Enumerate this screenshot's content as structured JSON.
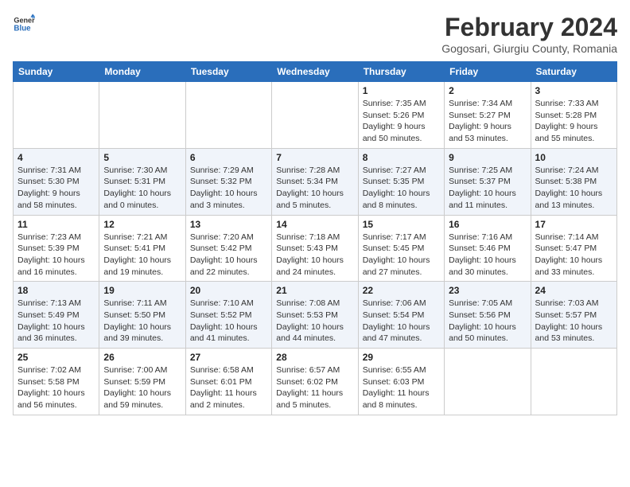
{
  "header": {
    "logo_line1": "General",
    "logo_line2": "Blue",
    "month_year": "February 2024",
    "location": "Gogosari, Giurgiu County, Romania"
  },
  "weekdays": [
    "Sunday",
    "Monday",
    "Tuesday",
    "Wednesday",
    "Thursday",
    "Friday",
    "Saturday"
  ],
  "weeks": [
    [
      {
        "day": "",
        "info": ""
      },
      {
        "day": "",
        "info": ""
      },
      {
        "day": "",
        "info": ""
      },
      {
        "day": "",
        "info": ""
      },
      {
        "day": "1",
        "info": "Sunrise: 7:35 AM\nSunset: 5:26 PM\nDaylight: 9 hours\nand 50 minutes."
      },
      {
        "day": "2",
        "info": "Sunrise: 7:34 AM\nSunset: 5:27 PM\nDaylight: 9 hours\nand 53 minutes."
      },
      {
        "day": "3",
        "info": "Sunrise: 7:33 AM\nSunset: 5:28 PM\nDaylight: 9 hours\nand 55 minutes."
      }
    ],
    [
      {
        "day": "4",
        "info": "Sunrise: 7:31 AM\nSunset: 5:30 PM\nDaylight: 9 hours\nand 58 minutes."
      },
      {
        "day": "5",
        "info": "Sunrise: 7:30 AM\nSunset: 5:31 PM\nDaylight: 10 hours\nand 0 minutes."
      },
      {
        "day": "6",
        "info": "Sunrise: 7:29 AM\nSunset: 5:32 PM\nDaylight: 10 hours\nand 3 minutes."
      },
      {
        "day": "7",
        "info": "Sunrise: 7:28 AM\nSunset: 5:34 PM\nDaylight: 10 hours\nand 5 minutes."
      },
      {
        "day": "8",
        "info": "Sunrise: 7:27 AM\nSunset: 5:35 PM\nDaylight: 10 hours\nand 8 minutes."
      },
      {
        "day": "9",
        "info": "Sunrise: 7:25 AM\nSunset: 5:37 PM\nDaylight: 10 hours\nand 11 minutes."
      },
      {
        "day": "10",
        "info": "Sunrise: 7:24 AM\nSunset: 5:38 PM\nDaylight: 10 hours\nand 13 minutes."
      }
    ],
    [
      {
        "day": "11",
        "info": "Sunrise: 7:23 AM\nSunset: 5:39 PM\nDaylight: 10 hours\nand 16 minutes."
      },
      {
        "day": "12",
        "info": "Sunrise: 7:21 AM\nSunset: 5:41 PM\nDaylight: 10 hours\nand 19 minutes."
      },
      {
        "day": "13",
        "info": "Sunrise: 7:20 AM\nSunset: 5:42 PM\nDaylight: 10 hours\nand 22 minutes."
      },
      {
        "day": "14",
        "info": "Sunrise: 7:18 AM\nSunset: 5:43 PM\nDaylight: 10 hours\nand 24 minutes."
      },
      {
        "day": "15",
        "info": "Sunrise: 7:17 AM\nSunset: 5:45 PM\nDaylight: 10 hours\nand 27 minutes."
      },
      {
        "day": "16",
        "info": "Sunrise: 7:16 AM\nSunset: 5:46 PM\nDaylight: 10 hours\nand 30 minutes."
      },
      {
        "day": "17",
        "info": "Sunrise: 7:14 AM\nSunset: 5:47 PM\nDaylight: 10 hours\nand 33 minutes."
      }
    ],
    [
      {
        "day": "18",
        "info": "Sunrise: 7:13 AM\nSunset: 5:49 PM\nDaylight: 10 hours\nand 36 minutes."
      },
      {
        "day": "19",
        "info": "Sunrise: 7:11 AM\nSunset: 5:50 PM\nDaylight: 10 hours\nand 39 minutes."
      },
      {
        "day": "20",
        "info": "Sunrise: 7:10 AM\nSunset: 5:52 PM\nDaylight: 10 hours\nand 41 minutes."
      },
      {
        "day": "21",
        "info": "Sunrise: 7:08 AM\nSunset: 5:53 PM\nDaylight: 10 hours\nand 44 minutes."
      },
      {
        "day": "22",
        "info": "Sunrise: 7:06 AM\nSunset: 5:54 PM\nDaylight: 10 hours\nand 47 minutes."
      },
      {
        "day": "23",
        "info": "Sunrise: 7:05 AM\nSunset: 5:56 PM\nDaylight: 10 hours\nand 50 minutes."
      },
      {
        "day": "24",
        "info": "Sunrise: 7:03 AM\nSunset: 5:57 PM\nDaylight: 10 hours\nand 53 minutes."
      }
    ],
    [
      {
        "day": "25",
        "info": "Sunrise: 7:02 AM\nSunset: 5:58 PM\nDaylight: 10 hours\nand 56 minutes."
      },
      {
        "day": "26",
        "info": "Sunrise: 7:00 AM\nSunset: 5:59 PM\nDaylight: 10 hours\nand 59 minutes."
      },
      {
        "day": "27",
        "info": "Sunrise: 6:58 AM\nSunset: 6:01 PM\nDaylight: 11 hours\nand 2 minutes."
      },
      {
        "day": "28",
        "info": "Sunrise: 6:57 AM\nSunset: 6:02 PM\nDaylight: 11 hours\nand 5 minutes."
      },
      {
        "day": "29",
        "info": "Sunrise: 6:55 AM\nSunset: 6:03 PM\nDaylight: 11 hours\nand 8 minutes."
      },
      {
        "day": "",
        "info": ""
      },
      {
        "day": "",
        "info": ""
      }
    ]
  ]
}
